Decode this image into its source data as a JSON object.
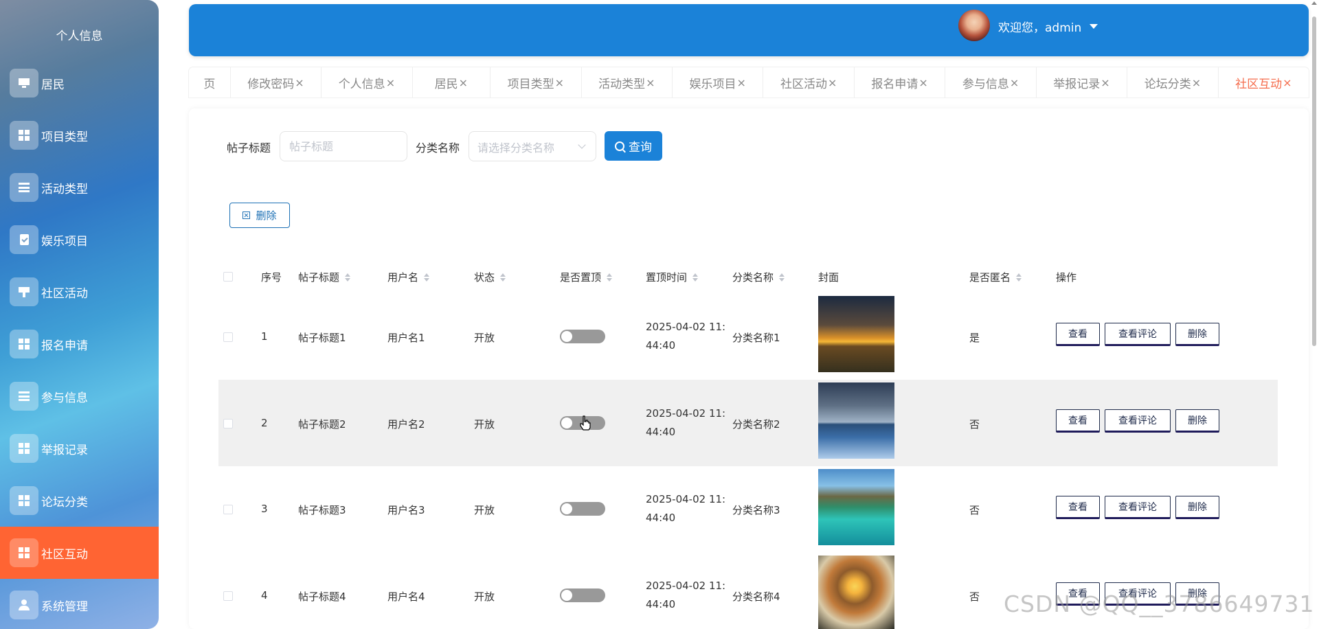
{
  "sidebar": {
    "title": "个人信息",
    "items": [
      {
        "label": "居民",
        "icon": "monitor-icon"
      },
      {
        "label": "项目类型",
        "icon": "grid-icon"
      },
      {
        "label": "活动类型",
        "icon": "list-icon"
      },
      {
        "label": "娱乐项目",
        "icon": "clipboard-icon"
      },
      {
        "label": "社区活动",
        "icon": "stand-icon"
      },
      {
        "label": "报名申请",
        "icon": "grid-icon"
      },
      {
        "label": "参与信息",
        "icon": "list-icon"
      },
      {
        "label": "举报记录",
        "icon": "grid-icon"
      },
      {
        "label": "论坛分类",
        "icon": "grid-icon"
      },
      {
        "label": "社区互动",
        "icon": "grid-icon",
        "active": true
      },
      {
        "label": "系统管理",
        "icon": "user-icon"
      }
    ]
  },
  "header": {
    "welcome": "欢迎您，admin",
    "avatar_icon": "user-avatar",
    "bg_color": "#1b82d8"
  },
  "tabs": [
    {
      "label": "页",
      "closable": false
    },
    {
      "label": "修改密码",
      "closable": true
    },
    {
      "label": "个人信息",
      "closable": true
    },
    {
      "label": "居民",
      "closable": true
    },
    {
      "label": "项目类型",
      "closable": true
    },
    {
      "label": "活动类型",
      "closable": true
    },
    {
      "label": "娱乐项目",
      "closable": true
    },
    {
      "label": "社区活动",
      "closable": true
    },
    {
      "label": "报名申请",
      "closable": true
    },
    {
      "label": "参与信息",
      "closable": true
    },
    {
      "label": "举报记录",
      "closable": true
    },
    {
      "label": "论坛分类",
      "closable": true
    },
    {
      "label": "社区互动",
      "closable": true,
      "active": true
    }
  ],
  "tab_close_glyph": "×",
  "search": {
    "title_label": "帖子标题",
    "title_placeholder": "帖子标题",
    "category_label": "分类名称",
    "category_placeholder": "请选择分类名称",
    "query_button": "查询"
  },
  "toolbar": {
    "delete_button": "删除"
  },
  "table": {
    "headers": [
      "序号",
      "帖子标题",
      "用户名",
      "状态",
      "是否置顶",
      "置顶时间",
      "分类名称",
      "封面",
      "是否匿名",
      "操作"
    ],
    "rows": [
      {
        "index": "1",
        "title": "帖子标题1",
        "user": "用户名1",
        "status": "开放",
        "pinned": false,
        "time_line1": "2025-04-02 11:",
        "time_line2": "44:40",
        "category": "分类名称1",
        "cover": "sunset-field-photo",
        "anonymous": "是"
      },
      {
        "index": "2",
        "title": "帖子标题2",
        "user": "用户名2",
        "status": "开放",
        "pinned": false,
        "time_line1": "2025-04-02 11:",
        "time_line2": "44:40",
        "category": "分类名称2",
        "cover": "frozen-lake-photo",
        "anonymous": "否"
      },
      {
        "index": "3",
        "title": "帖子标题3",
        "user": "用户名3",
        "status": "开放",
        "pinned": false,
        "time_line1": "2025-04-02 11:",
        "time_line2": "44:40",
        "category": "分类名称3",
        "cover": "tropical-bungalow-photo",
        "anonymous": "否"
      },
      {
        "index": "4",
        "title": "帖子标题4",
        "user": "用户名4",
        "status": "开放",
        "pinned": false,
        "time_line1": "2025-04-02 11:",
        "time_line2": "44:40",
        "category": "分类名称4",
        "cover": "food-plate-photo",
        "anonymous": "否"
      }
    ],
    "actions": {
      "view": "查看",
      "view_comments": "查看评论",
      "delete": "删除"
    }
  },
  "watermark": "CSDN @QQ__3786649731",
  "colors": {
    "accent": "#1b82d8",
    "active_menu": "#ff6433",
    "active_tab": "#f56c4c"
  }
}
